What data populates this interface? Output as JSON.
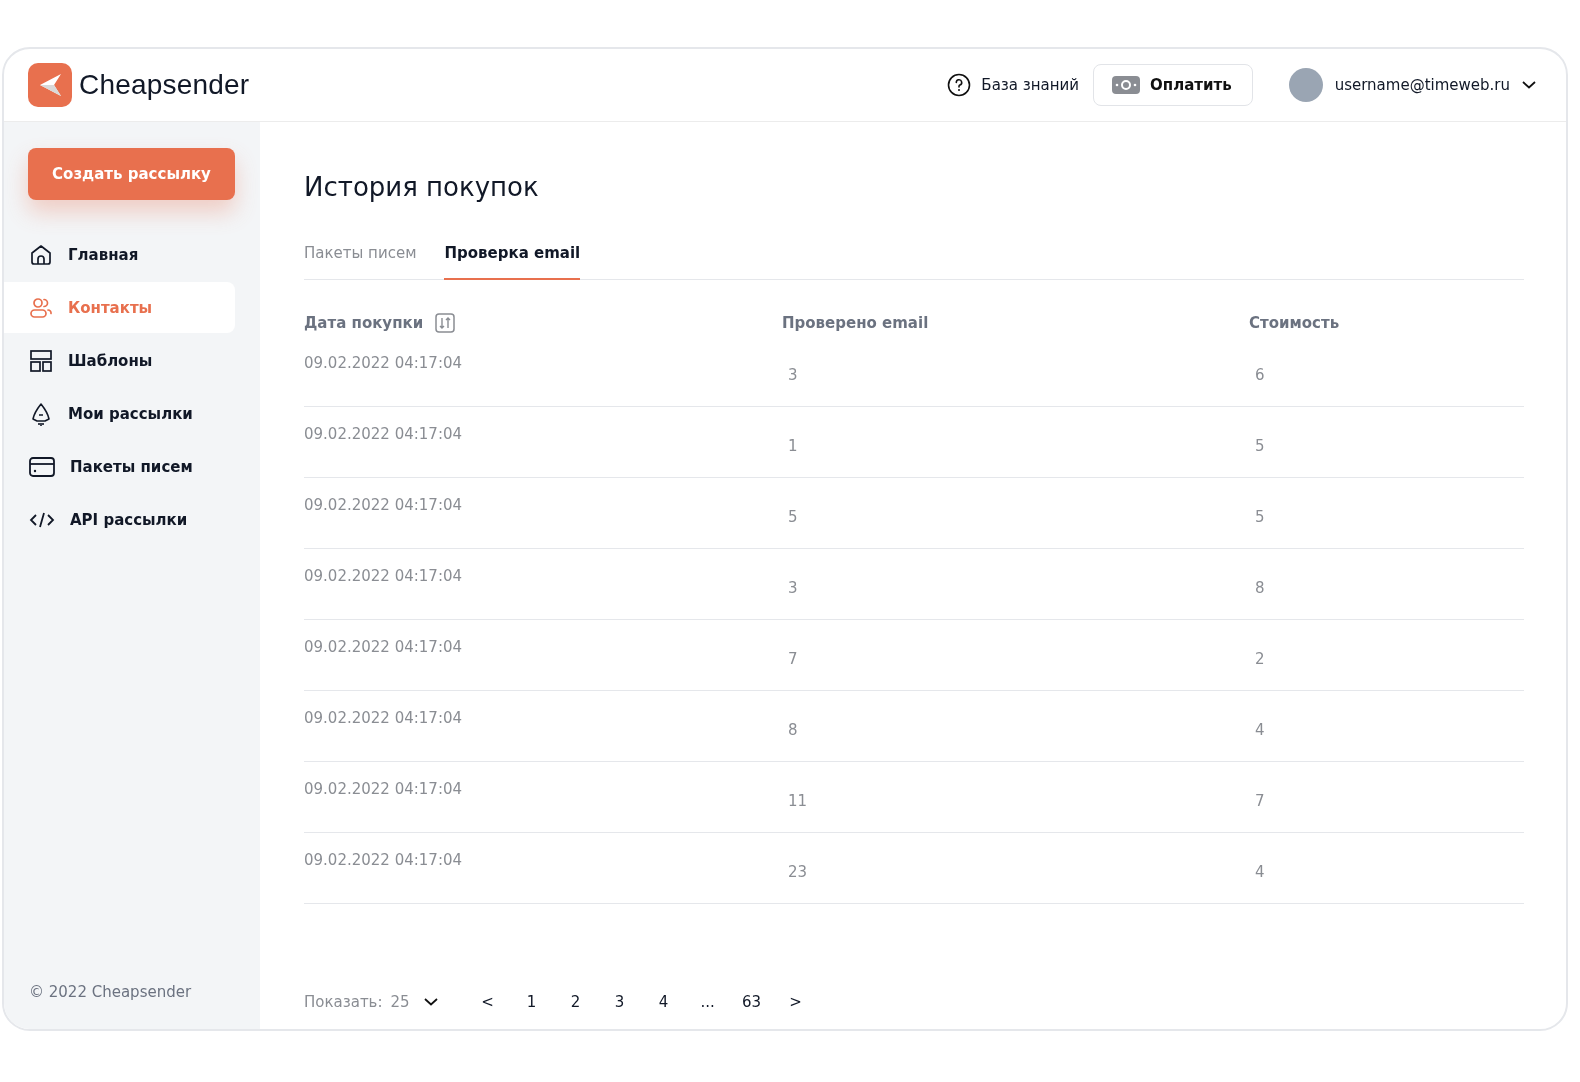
{
  "header": {
    "logo": "Cheapsender",
    "help": "База знаний",
    "pay_button": "Оплатить",
    "user": "username@timeweb.ru"
  },
  "sidebar": {
    "create_button": "Создать рассылку",
    "items": [
      {
        "label": "Главная",
        "selected": false
      },
      {
        "label": "Контакты",
        "selected": true
      },
      {
        "label": "Шаблоны",
        "selected": false
      },
      {
        "label": "Мои рассылки",
        "selected": false
      },
      {
        "label": "Пакеты писем",
        "selected": false
      },
      {
        "label": "API рассылки",
        "selected": false
      }
    ],
    "footer": "© 2022 Cheapsender"
  },
  "page": {
    "title": "История покупок",
    "tabs": [
      {
        "label": "Пакеты писем",
        "selected": false
      },
      {
        "label": "Проверка email",
        "selected": true
      }
    ],
    "table": {
      "columns": [
        "Дата покупки",
        "Проверено email",
        "Стоимость"
      ],
      "rows": [
        [
          "09.02.2022 04:17:04",
          "3",
          "6"
        ],
        [
          "09.02.2022 04:17:04",
          "1",
          "5"
        ],
        [
          "09.02.2022 04:17:04",
          "5",
          "5"
        ],
        [
          "09.02.2022 04:17:04",
          "3",
          "8"
        ],
        [
          "09.02.2022 04:17:04",
          "7",
          "2"
        ],
        [
          "09.02.2022 04:17:04",
          "8",
          "4"
        ],
        [
          "09.02.2022 04:17:04",
          "11",
          "7"
        ],
        [
          "09.02.2022 04:17:04",
          "23",
          "4"
        ]
      ]
    },
    "pagination": {
      "show_label": "Показать:",
      "page_size": "25",
      "prev": "<",
      "pages": [
        "1",
        "2",
        "3",
        "4",
        "...",
        "63"
      ],
      "next": ">"
    }
  }
}
